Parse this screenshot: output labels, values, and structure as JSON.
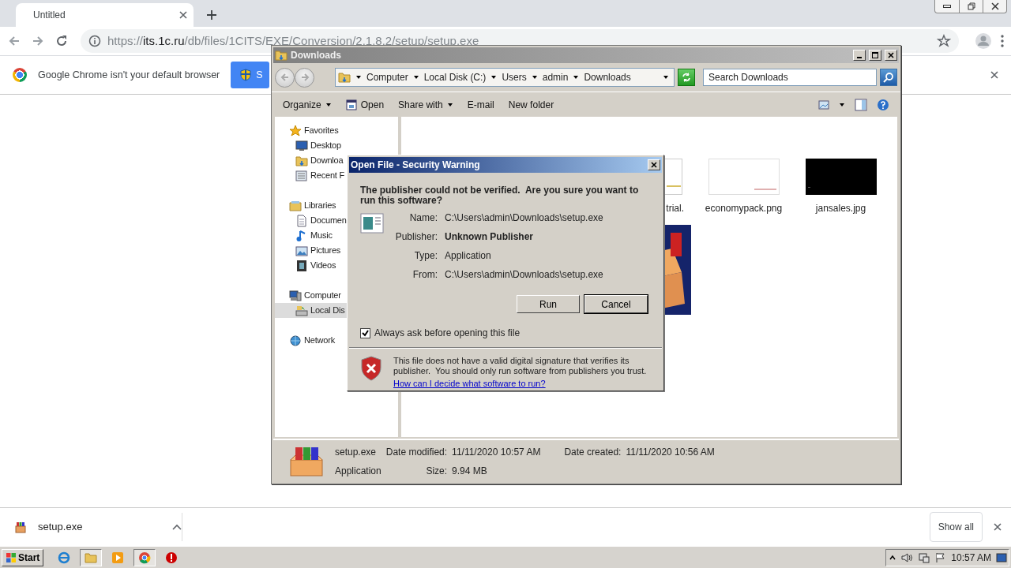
{
  "browser": {
    "tabs": [
      {
        "title": "Untitled",
        "selected": true
      }
    ],
    "address": {
      "scheme": "https://",
      "host": "its.1c.ru",
      "path": "/db/files/1CITS/EXE/Conversion/2.1.8.2/setup/setup.exe"
    },
    "infobar": {
      "message": "Google Chrome isn't your default browser",
      "button": "S"
    }
  },
  "explorer": {
    "title": "Downloads",
    "breadcrumb": [
      "Computer",
      "Local Disk (C:)",
      "Users",
      "admin",
      "Downloads"
    ],
    "search": {
      "placeholder": "Search Downloads"
    },
    "toolbar": [
      {
        "label": "Organize",
        "kind": "menu"
      },
      {
        "label": "Open",
        "kind": "open"
      },
      {
        "label": "Share with",
        "kind": "menu"
      },
      {
        "label": "E-mail",
        "kind": "plain"
      },
      {
        "label": "New folder",
        "kind": "plain"
      }
    ],
    "nav": [
      {
        "label": "Favorites",
        "kind": "star",
        "selected": false,
        "children": [
          {
            "label": "Desktop",
            "kind": "desktop",
            "selected": false
          },
          {
            "label": "Downloa",
            "kind": "folder",
            "selected": false
          },
          {
            "label": "Recent F",
            "kind": "recent",
            "selected": false
          }
        ]
      },
      {
        "label": "Libraries",
        "kind": "library",
        "selected": false,
        "children": [
          {
            "label": "Documen",
            "kind": "document",
            "selected": false
          },
          {
            "label": "Music",
            "kind": "music",
            "selected": false
          },
          {
            "label": "Pictures",
            "kind": "pictures",
            "selected": false
          },
          {
            "label": "Videos",
            "kind": "videos",
            "selected": false
          }
        ]
      },
      {
        "label": "Computer",
        "kind": "computer",
        "selected": false,
        "children": [
          {
            "label": "Local Dis",
            "kind": "disk",
            "selected": true
          }
        ]
      },
      {
        "label": "Network",
        "kind": "network",
        "selected": false
      }
    ],
    "files": [
      {
        "label": "trial.",
        "kind": "light"
      },
      {
        "label": "economypack.png",
        "kind": "blank"
      },
      {
        "label": "jansales.jpg",
        "kind": "dark"
      },
      {
        "kind": "installer"
      }
    ],
    "details": {
      "name": "setup.exe",
      "type": "Application",
      "fields": [
        {
          "label": "Date modified:",
          "value": "11/11/2020 10:57 AM"
        },
        {
          "label": "Date created:",
          "value": "11/11/2020 10:56 AM"
        },
        {
          "label": "Size:",
          "value": "9.94 MB"
        }
      ]
    }
  },
  "dialog": {
    "title": "Open File - Security Warning",
    "heading": "The publisher could not be verified.  Are you sure you want to run this software?",
    "fields": [
      {
        "label": "Name:",
        "value": "C:\\Users\\admin\\Downloads\\setup.exe",
        "emphasis": false
      },
      {
        "label": "Publisher:",
        "value": "Unknown Publisher",
        "emphasis": true
      },
      {
        "label": "Type:",
        "value": "Application",
        "emphasis": false
      },
      {
        "label": "From:",
        "value": "C:\\Users\\admin\\Downloads\\setup.exe",
        "emphasis": false
      }
    ],
    "buttons": [
      {
        "label": "Run",
        "default": false
      },
      {
        "label": "Cancel",
        "default": true
      }
    ],
    "always_ask": {
      "label": "Always ask before opening this file",
      "checked": true
    },
    "warning": "This file does not have a valid digital signature that verifies its publisher.  You should only run software from publishers you trust.",
    "link": "How can I decide what software to run?"
  },
  "download_bar": {
    "file": "setup.exe",
    "show_all": "Show all"
  },
  "taskbar": {
    "start": "Start",
    "apps": [
      {
        "kind": "ie",
        "active": false
      },
      {
        "kind": "explorer",
        "active": true
      },
      {
        "kind": "media",
        "active": false
      },
      {
        "kind": "chrome",
        "active": true
      },
      {
        "kind": "stop",
        "active": false
      }
    ],
    "clock": "10:57 AM"
  }
}
